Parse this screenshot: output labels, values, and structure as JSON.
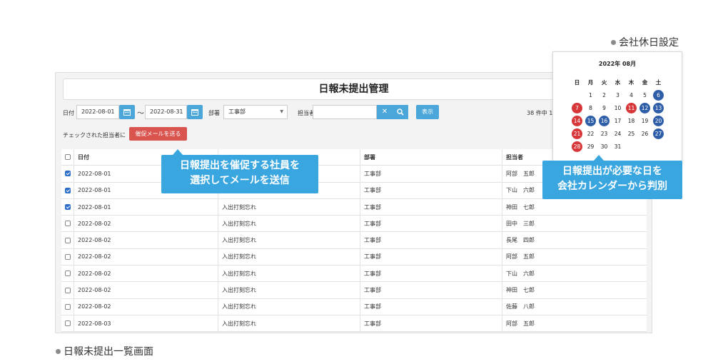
{
  "captions": {
    "holiday_setting": "会社休日設定",
    "list_screen": "日報未提出一覧画面"
  },
  "title": "日報未提出管理",
  "filter": {
    "date_label": "日付",
    "date_from": "2022-08-01",
    "tilde": "〜",
    "date_to": "2022-08-31",
    "dept_label": "部署",
    "dept_value": "工事部",
    "person_label": "担当者",
    "person_value": "",
    "clear_icon": "x-icon",
    "search_icon": "search-icon",
    "show_button": "表示",
    "count_text": "38 件中 1"
  },
  "mail": {
    "label": "チェックされた担当者に",
    "button": "催促メールを送る"
  },
  "table": {
    "headers": [
      "日付",
      "",
      "部署",
      "担当者"
    ],
    "rows": [
      {
        "checked": true,
        "date": "2022-08-01",
        "reason": "",
        "dept": "工事部",
        "person": "阿部　五郎"
      },
      {
        "checked": true,
        "date": "2022-08-01",
        "reason": "",
        "dept": "工事部",
        "person": "下山　六郎"
      },
      {
        "checked": true,
        "date": "2022-08-01",
        "reason": "入出打刻忘れ",
        "dept": "工事部",
        "person": "神田　七郎"
      },
      {
        "checked": false,
        "date": "2022-08-02",
        "reason": "入出打刻忘れ",
        "dept": "工事部",
        "person": "田中　三郎"
      },
      {
        "checked": false,
        "date": "2022-08-02",
        "reason": "入出打刻忘れ",
        "dept": "工事部",
        "person": "長尾　四郎"
      },
      {
        "checked": false,
        "date": "2022-08-02",
        "reason": "入出打刻忘れ",
        "dept": "工事部",
        "person": "阿部　五郎"
      },
      {
        "checked": false,
        "date": "2022-08-02",
        "reason": "入出打刻忘れ",
        "dept": "工事部",
        "person": "下山　六郎"
      },
      {
        "checked": false,
        "date": "2022-08-02",
        "reason": "入出打刻忘れ",
        "dept": "工事部",
        "person": "神田　七郎"
      },
      {
        "checked": false,
        "date": "2022-08-02",
        "reason": "入出打刻忘れ",
        "dept": "工事部",
        "person": "佐藤　八郎"
      },
      {
        "checked": false,
        "date": "2022-08-03",
        "reason": "入出打刻忘れ",
        "dept": "工事部",
        "person": "阿部　五郎"
      }
    ]
  },
  "callouts": {
    "mail_line1": "日報提出を催促する社員を",
    "mail_line2": "選択してメールを送信",
    "cal_line1": "日報提出が必要な日を",
    "cal_line2": "会社カレンダーから判別"
  },
  "calendar": {
    "title": "2022年 08月",
    "weekdays": [
      "日",
      "月",
      "火",
      "水",
      "木",
      "金",
      "土"
    ],
    "cells": [
      {
        "d": ""
      },
      {
        "d": "1"
      },
      {
        "d": "2"
      },
      {
        "d": "3"
      },
      {
        "d": "4"
      },
      {
        "d": "5"
      },
      {
        "d": "6",
        "mark": "blue"
      },
      {
        "d": "7",
        "mark": "red"
      },
      {
        "d": "8"
      },
      {
        "d": "9"
      },
      {
        "d": "10"
      },
      {
        "d": "11",
        "mark": "red"
      },
      {
        "d": "12",
        "mark": "blue"
      },
      {
        "d": "13",
        "mark": "blue"
      },
      {
        "d": "14",
        "mark": "red"
      },
      {
        "d": "15",
        "mark": "blue"
      },
      {
        "d": "16",
        "mark": "blue"
      },
      {
        "d": "17"
      },
      {
        "d": "18"
      },
      {
        "d": "19"
      },
      {
        "d": "20",
        "mark": "blue"
      },
      {
        "d": "21",
        "mark": "red"
      },
      {
        "d": "22"
      },
      {
        "d": "23"
      },
      {
        "d": "24"
      },
      {
        "d": "25"
      },
      {
        "d": "26"
      },
      {
        "d": "27",
        "mark": "blue"
      },
      {
        "d": "28",
        "mark": "red"
      },
      {
        "d": "29"
      },
      {
        "d": "30"
      },
      {
        "d": "31"
      },
      {
        "d": ""
      },
      {
        "d": ""
      },
      {
        "d": ""
      }
    ],
    "colors": {
      "holiday_red": "#d8373a",
      "holiday_blue": "#2f5ea9"
    }
  },
  "colors": {
    "accent": "#4ba6d9",
    "callout": "#3aa6e0",
    "danger": "#d9534f"
  }
}
